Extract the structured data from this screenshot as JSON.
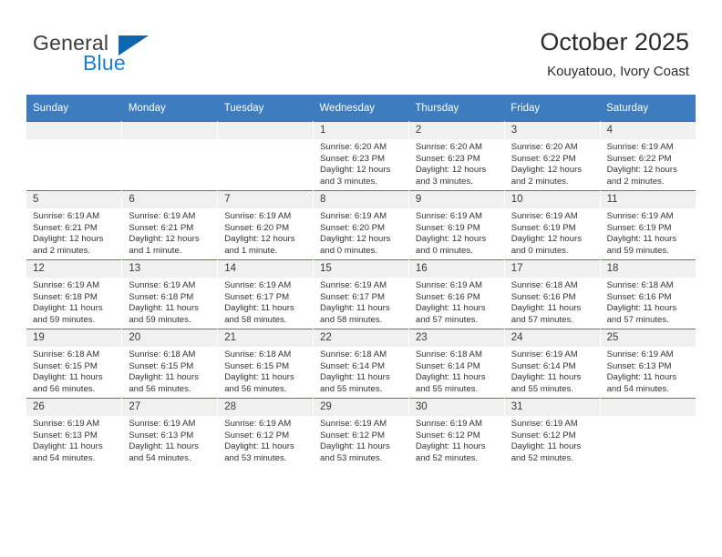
{
  "brand": {
    "name_part1": "General",
    "name_part2": "Blue",
    "logo_icon": "triangle-logo-icon",
    "accent_color": "#0c66b0",
    "blue_text_color": "#1a7fd4"
  },
  "header": {
    "title": "October 2025",
    "subtitle": "Kouyatouo, Ivory Coast"
  },
  "calendar": {
    "header_bg_color": "#3c7cbf",
    "daynum_bg_color": "#f0f0f0",
    "weekday_headers": [
      "Sunday",
      "Monday",
      "Tuesday",
      "Wednesday",
      "Thursday",
      "Friday",
      "Saturday"
    ],
    "weeks": [
      [
        {
          "day": "",
          "empty": true,
          "sunrise": "",
          "sunset": "",
          "daylight1": "",
          "daylight2": ""
        },
        {
          "day": "",
          "empty": true,
          "sunrise": "",
          "sunset": "",
          "daylight1": "",
          "daylight2": ""
        },
        {
          "day": "",
          "empty": true,
          "sunrise": "",
          "sunset": "",
          "daylight1": "",
          "daylight2": ""
        },
        {
          "day": "1",
          "empty": false,
          "sunrise": "Sunrise: 6:20 AM",
          "sunset": "Sunset: 6:23 PM",
          "daylight1": "Daylight: 12 hours",
          "daylight2": "and 3 minutes."
        },
        {
          "day": "2",
          "empty": false,
          "sunrise": "Sunrise: 6:20 AM",
          "sunset": "Sunset: 6:23 PM",
          "daylight1": "Daylight: 12 hours",
          "daylight2": "and 3 minutes."
        },
        {
          "day": "3",
          "empty": false,
          "sunrise": "Sunrise: 6:20 AM",
          "sunset": "Sunset: 6:22 PM",
          "daylight1": "Daylight: 12 hours",
          "daylight2": "and 2 minutes."
        },
        {
          "day": "4",
          "empty": false,
          "sunrise": "Sunrise: 6:19 AM",
          "sunset": "Sunset: 6:22 PM",
          "daylight1": "Daylight: 12 hours",
          "daylight2": "and 2 minutes."
        }
      ],
      [
        {
          "day": "5",
          "empty": false,
          "sunrise": "Sunrise: 6:19 AM",
          "sunset": "Sunset: 6:21 PM",
          "daylight1": "Daylight: 12 hours",
          "daylight2": "and 2 minutes."
        },
        {
          "day": "6",
          "empty": false,
          "sunrise": "Sunrise: 6:19 AM",
          "sunset": "Sunset: 6:21 PM",
          "daylight1": "Daylight: 12 hours",
          "daylight2": "and 1 minute."
        },
        {
          "day": "7",
          "empty": false,
          "sunrise": "Sunrise: 6:19 AM",
          "sunset": "Sunset: 6:20 PM",
          "daylight1": "Daylight: 12 hours",
          "daylight2": "and 1 minute."
        },
        {
          "day": "8",
          "empty": false,
          "sunrise": "Sunrise: 6:19 AM",
          "sunset": "Sunset: 6:20 PM",
          "daylight1": "Daylight: 12 hours",
          "daylight2": "and 0 minutes."
        },
        {
          "day": "9",
          "empty": false,
          "sunrise": "Sunrise: 6:19 AM",
          "sunset": "Sunset: 6:19 PM",
          "daylight1": "Daylight: 12 hours",
          "daylight2": "and 0 minutes."
        },
        {
          "day": "10",
          "empty": false,
          "sunrise": "Sunrise: 6:19 AM",
          "sunset": "Sunset: 6:19 PM",
          "daylight1": "Daylight: 12 hours",
          "daylight2": "and 0 minutes."
        },
        {
          "day": "11",
          "empty": false,
          "sunrise": "Sunrise: 6:19 AM",
          "sunset": "Sunset: 6:19 PM",
          "daylight1": "Daylight: 11 hours",
          "daylight2": "and 59 minutes."
        }
      ],
      [
        {
          "day": "12",
          "empty": false,
          "sunrise": "Sunrise: 6:19 AM",
          "sunset": "Sunset: 6:18 PM",
          "daylight1": "Daylight: 11 hours",
          "daylight2": "and 59 minutes."
        },
        {
          "day": "13",
          "empty": false,
          "sunrise": "Sunrise: 6:19 AM",
          "sunset": "Sunset: 6:18 PM",
          "daylight1": "Daylight: 11 hours",
          "daylight2": "and 59 minutes."
        },
        {
          "day": "14",
          "empty": false,
          "sunrise": "Sunrise: 6:19 AM",
          "sunset": "Sunset: 6:17 PM",
          "daylight1": "Daylight: 11 hours",
          "daylight2": "and 58 minutes."
        },
        {
          "day": "15",
          "empty": false,
          "sunrise": "Sunrise: 6:19 AM",
          "sunset": "Sunset: 6:17 PM",
          "daylight1": "Daylight: 11 hours",
          "daylight2": "and 58 minutes."
        },
        {
          "day": "16",
          "empty": false,
          "sunrise": "Sunrise: 6:19 AM",
          "sunset": "Sunset: 6:16 PM",
          "daylight1": "Daylight: 11 hours",
          "daylight2": "and 57 minutes."
        },
        {
          "day": "17",
          "empty": false,
          "sunrise": "Sunrise: 6:18 AM",
          "sunset": "Sunset: 6:16 PM",
          "daylight1": "Daylight: 11 hours",
          "daylight2": "and 57 minutes."
        },
        {
          "day": "18",
          "empty": false,
          "sunrise": "Sunrise: 6:18 AM",
          "sunset": "Sunset: 6:16 PM",
          "daylight1": "Daylight: 11 hours",
          "daylight2": "and 57 minutes."
        }
      ],
      [
        {
          "day": "19",
          "empty": false,
          "sunrise": "Sunrise: 6:18 AM",
          "sunset": "Sunset: 6:15 PM",
          "daylight1": "Daylight: 11 hours",
          "daylight2": "and 56 minutes."
        },
        {
          "day": "20",
          "empty": false,
          "sunrise": "Sunrise: 6:18 AM",
          "sunset": "Sunset: 6:15 PM",
          "daylight1": "Daylight: 11 hours",
          "daylight2": "and 56 minutes."
        },
        {
          "day": "21",
          "empty": false,
          "sunrise": "Sunrise: 6:18 AM",
          "sunset": "Sunset: 6:15 PM",
          "daylight1": "Daylight: 11 hours",
          "daylight2": "and 56 minutes."
        },
        {
          "day": "22",
          "empty": false,
          "sunrise": "Sunrise: 6:18 AM",
          "sunset": "Sunset: 6:14 PM",
          "daylight1": "Daylight: 11 hours",
          "daylight2": "and 55 minutes."
        },
        {
          "day": "23",
          "empty": false,
          "sunrise": "Sunrise: 6:18 AM",
          "sunset": "Sunset: 6:14 PM",
          "daylight1": "Daylight: 11 hours",
          "daylight2": "and 55 minutes."
        },
        {
          "day": "24",
          "empty": false,
          "sunrise": "Sunrise: 6:19 AM",
          "sunset": "Sunset: 6:14 PM",
          "daylight1": "Daylight: 11 hours",
          "daylight2": "and 55 minutes."
        },
        {
          "day": "25",
          "empty": false,
          "sunrise": "Sunrise: 6:19 AM",
          "sunset": "Sunset: 6:13 PM",
          "daylight1": "Daylight: 11 hours",
          "daylight2": "and 54 minutes."
        }
      ],
      [
        {
          "day": "26",
          "empty": false,
          "sunrise": "Sunrise: 6:19 AM",
          "sunset": "Sunset: 6:13 PM",
          "daylight1": "Daylight: 11 hours",
          "daylight2": "and 54 minutes."
        },
        {
          "day": "27",
          "empty": false,
          "sunrise": "Sunrise: 6:19 AM",
          "sunset": "Sunset: 6:13 PM",
          "daylight1": "Daylight: 11 hours",
          "daylight2": "and 54 minutes."
        },
        {
          "day": "28",
          "empty": false,
          "sunrise": "Sunrise: 6:19 AM",
          "sunset": "Sunset: 6:12 PM",
          "daylight1": "Daylight: 11 hours",
          "daylight2": "and 53 minutes."
        },
        {
          "day": "29",
          "empty": false,
          "sunrise": "Sunrise: 6:19 AM",
          "sunset": "Sunset: 6:12 PM",
          "daylight1": "Daylight: 11 hours",
          "daylight2": "and 53 minutes."
        },
        {
          "day": "30",
          "empty": false,
          "sunrise": "Sunrise: 6:19 AM",
          "sunset": "Sunset: 6:12 PM",
          "daylight1": "Daylight: 11 hours",
          "daylight2": "and 52 minutes."
        },
        {
          "day": "31",
          "empty": false,
          "sunrise": "Sunrise: 6:19 AM",
          "sunset": "Sunset: 6:12 PM",
          "daylight1": "Daylight: 11 hours",
          "daylight2": "and 52 minutes."
        },
        {
          "day": "",
          "empty": true,
          "sunrise": "",
          "sunset": "",
          "daylight1": "",
          "daylight2": ""
        }
      ]
    ]
  }
}
